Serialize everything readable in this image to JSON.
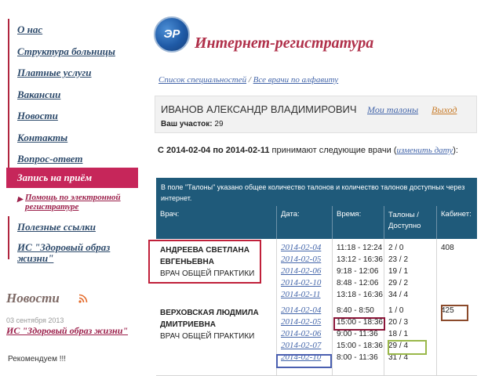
{
  "sidebar": {
    "items": [
      {
        "label": "О нас"
      },
      {
        "label": "Структура больницы"
      },
      {
        "label": "Платные услуги"
      },
      {
        "label": "Вакансии"
      },
      {
        "label": "Новости"
      },
      {
        "label": "Контакты"
      },
      {
        "label": "Вопрос-ответ"
      }
    ],
    "active_item": "Запись на приём",
    "sub_item": "Помощь по электронной регистратуре",
    "items_after": [
      {
        "label": "Полезные ссылки"
      },
      {
        "label": "ИС \"Здоровый образ жизни\""
      }
    ],
    "news": {
      "title": "Новости",
      "date": "03 сентября 2013",
      "link": "ИС \"Здоровый образ жизни\"",
      "text": "Рекомендуем !!!"
    }
  },
  "header": {
    "logo_text": "ЭР",
    "title": "Интернет-регистратура",
    "breadcrumb": {
      "link1": "Список специальностей",
      "separator": "/",
      "link2": "Все врачи по алфавиту"
    }
  },
  "user": {
    "name": "ИВАНОВ АЛЕКСАНДР ВЛАДИМИРОВИЧ",
    "my_tickets": "Мои талоны",
    "logout": "Выход",
    "district_label": "Ваш участок:",
    "district_value": "29"
  },
  "info": {
    "prefix": "С",
    "date_from": "2014-02-04",
    "middle": "по",
    "date_to": "2014-02-11",
    "suffix": "принимают следующие врачи (",
    "change_link": "изменить дату",
    "close": "):"
  },
  "table": {
    "note": "В поле \"Талоны\" указано общее количество талонов и количество талонов доступных через интернет.",
    "headers": {
      "doctor": "Врач:",
      "date": "Дата:",
      "time": "Время:",
      "tickets": "Талоны / Доступно",
      "cabinet": "Кабинет:"
    },
    "rows": [
      {
        "name_line1": "АНДРЕЕВА СВЕТЛАНА",
        "name_line2": "ЕВГЕНЬЕВНА",
        "specialty": "ВРАЧ ОБЩЕЙ ПРАКТИКИ",
        "cabinet": "408",
        "dates": [
          "2014-02-04",
          "2014-02-05",
          "2014-02-06",
          "2014-02-10",
          "2014-02-11"
        ],
        "times": [
          "11:18 - 12:24",
          "13:12 - 16:36",
          "9:18 - 12:06",
          "8:48 - 12:06",
          "13:18 - 16:36"
        ],
        "tickets": [
          "2 / 0",
          "23 / 2",
          "19 / 1",
          "29 / 2",
          "34 / 4"
        ]
      },
      {
        "name_line1": "ВЕРХОВСКАЯ ЛЮДМИЛА",
        "name_line2": "ДМИТРИЕВНА",
        "specialty": "ВРАЧ ОБЩЕЙ ПРАКТИКИ",
        "cabinet": "425",
        "dates": [
          "2014-02-04",
          "2014-02-05",
          "2014-02-06",
          "2014-02-07",
          "2014-02-10"
        ],
        "times": [
          "8:40 - 8:50",
          "15:00 - 18:36",
          "9:00 - 11:36",
          "15:00 - 18:36",
          "8:00 - 11:36"
        ],
        "tickets": [
          "1 / 0",
          "20 / 3",
          "18 / 1",
          "29 / 4",
          "31 / 4"
        ]
      }
    ]
  },
  "highlight_colors": {
    "doctor": "#c0203a",
    "time": "#8a1538",
    "cabinet": "#8b4a2b",
    "tickets": "#9ab84a",
    "date": "#4a5fb0"
  }
}
